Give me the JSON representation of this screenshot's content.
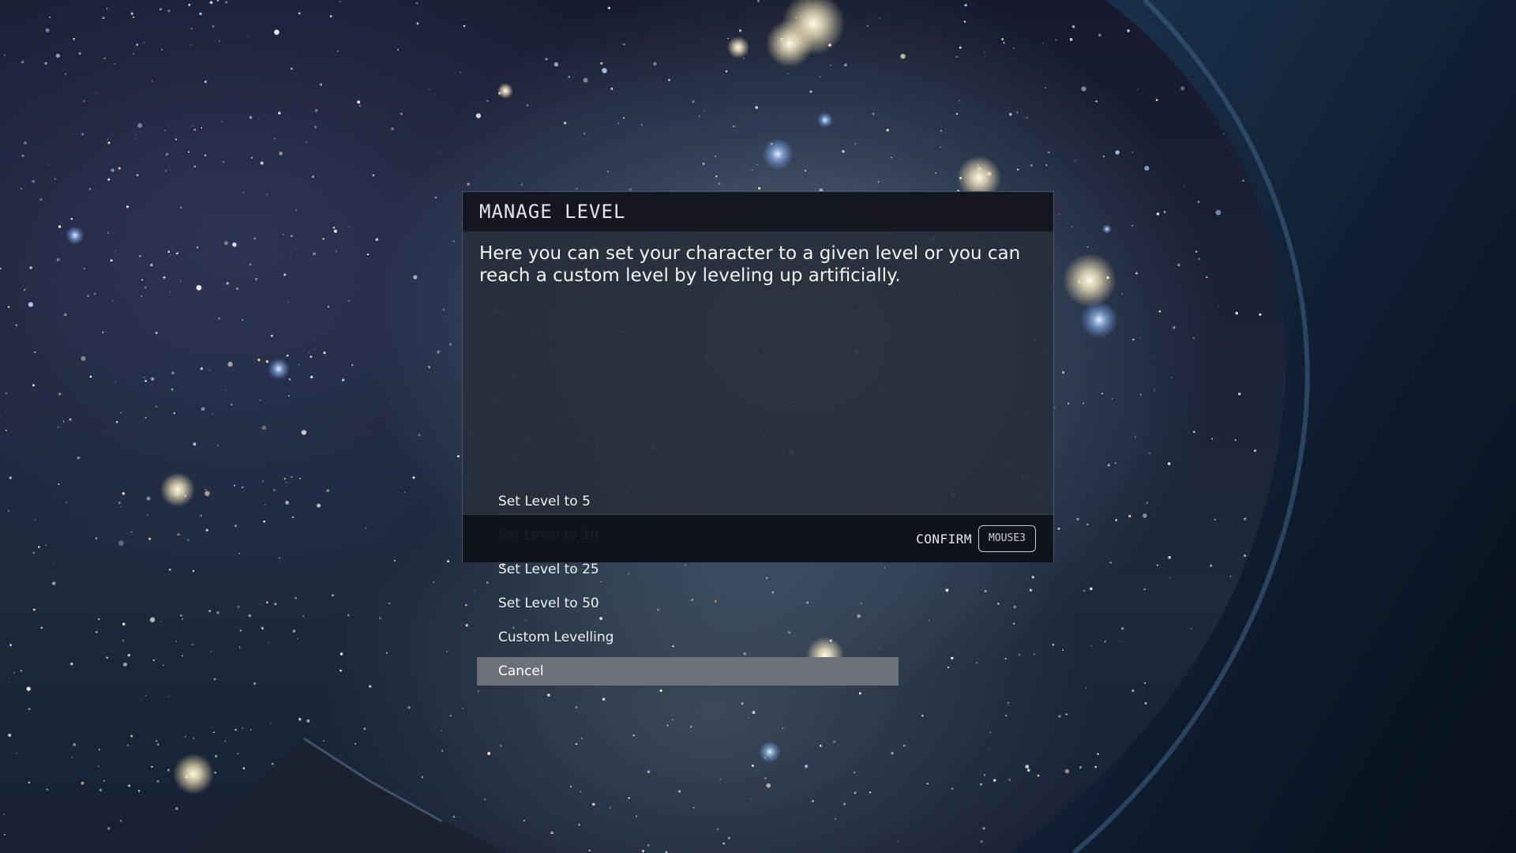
{
  "dialog": {
    "title": "MANAGE LEVEL",
    "description": "Here you can set your character to a given level or you can reach a custom level by leveling up artificially.",
    "options": [
      {
        "label": "Set Level to 5",
        "selected": false
      },
      {
        "label": "Set Level to 10",
        "selected": false
      },
      {
        "label": "Set Level to 25",
        "selected": false
      },
      {
        "label": "Set Level to 50",
        "selected": false
      },
      {
        "label": "Custom Levelling",
        "selected": false
      },
      {
        "label": "Cancel",
        "selected": true
      }
    ],
    "footer": {
      "confirm_label": "CONFIRM",
      "confirm_key": "MOUSE3"
    }
  },
  "colors": {
    "selected_row": "#6b7079",
    "dialog_body": "#282e3a",
    "dialog_header": "#12161f"
  }
}
